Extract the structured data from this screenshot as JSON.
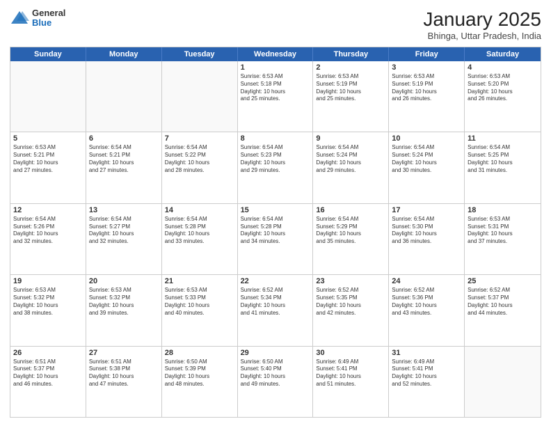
{
  "logo": {
    "general": "General",
    "blue": "Blue"
  },
  "title": "January 2025",
  "subtitle": "Bhinga, Uttar Pradesh, India",
  "days": [
    "Sunday",
    "Monday",
    "Tuesday",
    "Wednesday",
    "Thursday",
    "Friday",
    "Saturday"
  ],
  "weeks": [
    [
      {
        "day": "",
        "content": ""
      },
      {
        "day": "",
        "content": ""
      },
      {
        "day": "",
        "content": ""
      },
      {
        "day": "1",
        "content": "Sunrise: 6:53 AM\nSunset: 5:18 PM\nDaylight: 10 hours\nand 25 minutes."
      },
      {
        "day": "2",
        "content": "Sunrise: 6:53 AM\nSunset: 5:19 PM\nDaylight: 10 hours\nand 25 minutes."
      },
      {
        "day": "3",
        "content": "Sunrise: 6:53 AM\nSunset: 5:19 PM\nDaylight: 10 hours\nand 26 minutes."
      },
      {
        "day": "4",
        "content": "Sunrise: 6:53 AM\nSunset: 5:20 PM\nDaylight: 10 hours\nand 26 minutes."
      }
    ],
    [
      {
        "day": "5",
        "content": "Sunrise: 6:53 AM\nSunset: 5:21 PM\nDaylight: 10 hours\nand 27 minutes."
      },
      {
        "day": "6",
        "content": "Sunrise: 6:54 AM\nSunset: 5:21 PM\nDaylight: 10 hours\nand 27 minutes."
      },
      {
        "day": "7",
        "content": "Sunrise: 6:54 AM\nSunset: 5:22 PM\nDaylight: 10 hours\nand 28 minutes."
      },
      {
        "day": "8",
        "content": "Sunrise: 6:54 AM\nSunset: 5:23 PM\nDaylight: 10 hours\nand 29 minutes."
      },
      {
        "day": "9",
        "content": "Sunrise: 6:54 AM\nSunset: 5:24 PM\nDaylight: 10 hours\nand 29 minutes."
      },
      {
        "day": "10",
        "content": "Sunrise: 6:54 AM\nSunset: 5:24 PM\nDaylight: 10 hours\nand 30 minutes."
      },
      {
        "day": "11",
        "content": "Sunrise: 6:54 AM\nSunset: 5:25 PM\nDaylight: 10 hours\nand 31 minutes."
      }
    ],
    [
      {
        "day": "12",
        "content": "Sunrise: 6:54 AM\nSunset: 5:26 PM\nDaylight: 10 hours\nand 32 minutes."
      },
      {
        "day": "13",
        "content": "Sunrise: 6:54 AM\nSunset: 5:27 PM\nDaylight: 10 hours\nand 32 minutes."
      },
      {
        "day": "14",
        "content": "Sunrise: 6:54 AM\nSunset: 5:28 PM\nDaylight: 10 hours\nand 33 minutes."
      },
      {
        "day": "15",
        "content": "Sunrise: 6:54 AM\nSunset: 5:28 PM\nDaylight: 10 hours\nand 34 minutes."
      },
      {
        "day": "16",
        "content": "Sunrise: 6:54 AM\nSunset: 5:29 PM\nDaylight: 10 hours\nand 35 minutes."
      },
      {
        "day": "17",
        "content": "Sunrise: 6:54 AM\nSunset: 5:30 PM\nDaylight: 10 hours\nand 36 minutes."
      },
      {
        "day": "18",
        "content": "Sunrise: 6:53 AM\nSunset: 5:31 PM\nDaylight: 10 hours\nand 37 minutes."
      }
    ],
    [
      {
        "day": "19",
        "content": "Sunrise: 6:53 AM\nSunset: 5:32 PM\nDaylight: 10 hours\nand 38 minutes."
      },
      {
        "day": "20",
        "content": "Sunrise: 6:53 AM\nSunset: 5:32 PM\nDaylight: 10 hours\nand 39 minutes."
      },
      {
        "day": "21",
        "content": "Sunrise: 6:53 AM\nSunset: 5:33 PM\nDaylight: 10 hours\nand 40 minutes."
      },
      {
        "day": "22",
        "content": "Sunrise: 6:52 AM\nSunset: 5:34 PM\nDaylight: 10 hours\nand 41 minutes."
      },
      {
        "day": "23",
        "content": "Sunrise: 6:52 AM\nSunset: 5:35 PM\nDaylight: 10 hours\nand 42 minutes."
      },
      {
        "day": "24",
        "content": "Sunrise: 6:52 AM\nSunset: 5:36 PM\nDaylight: 10 hours\nand 43 minutes."
      },
      {
        "day": "25",
        "content": "Sunrise: 6:52 AM\nSunset: 5:37 PM\nDaylight: 10 hours\nand 44 minutes."
      }
    ],
    [
      {
        "day": "26",
        "content": "Sunrise: 6:51 AM\nSunset: 5:37 PM\nDaylight: 10 hours\nand 46 minutes."
      },
      {
        "day": "27",
        "content": "Sunrise: 6:51 AM\nSunset: 5:38 PM\nDaylight: 10 hours\nand 47 minutes."
      },
      {
        "day": "28",
        "content": "Sunrise: 6:50 AM\nSunset: 5:39 PM\nDaylight: 10 hours\nand 48 minutes."
      },
      {
        "day": "29",
        "content": "Sunrise: 6:50 AM\nSunset: 5:40 PM\nDaylight: 10 hours\nand 49 minutes."
      },
      {
        "day": "30",
        "content": "Sunrise: 6:49 AM\nSunset: 5:41 PM\nDaylight: 10 hours\nand 51 minutes."
      },
      {
        "day": "31",
        "content": "Sunrise: 6:49 AM\nSunset: 5:41 PM\nDaylight: 10 hours\nand 52 minutes."
      },
      {
        "day": "",
        "content": ""
      }
    ]
  ]
}
